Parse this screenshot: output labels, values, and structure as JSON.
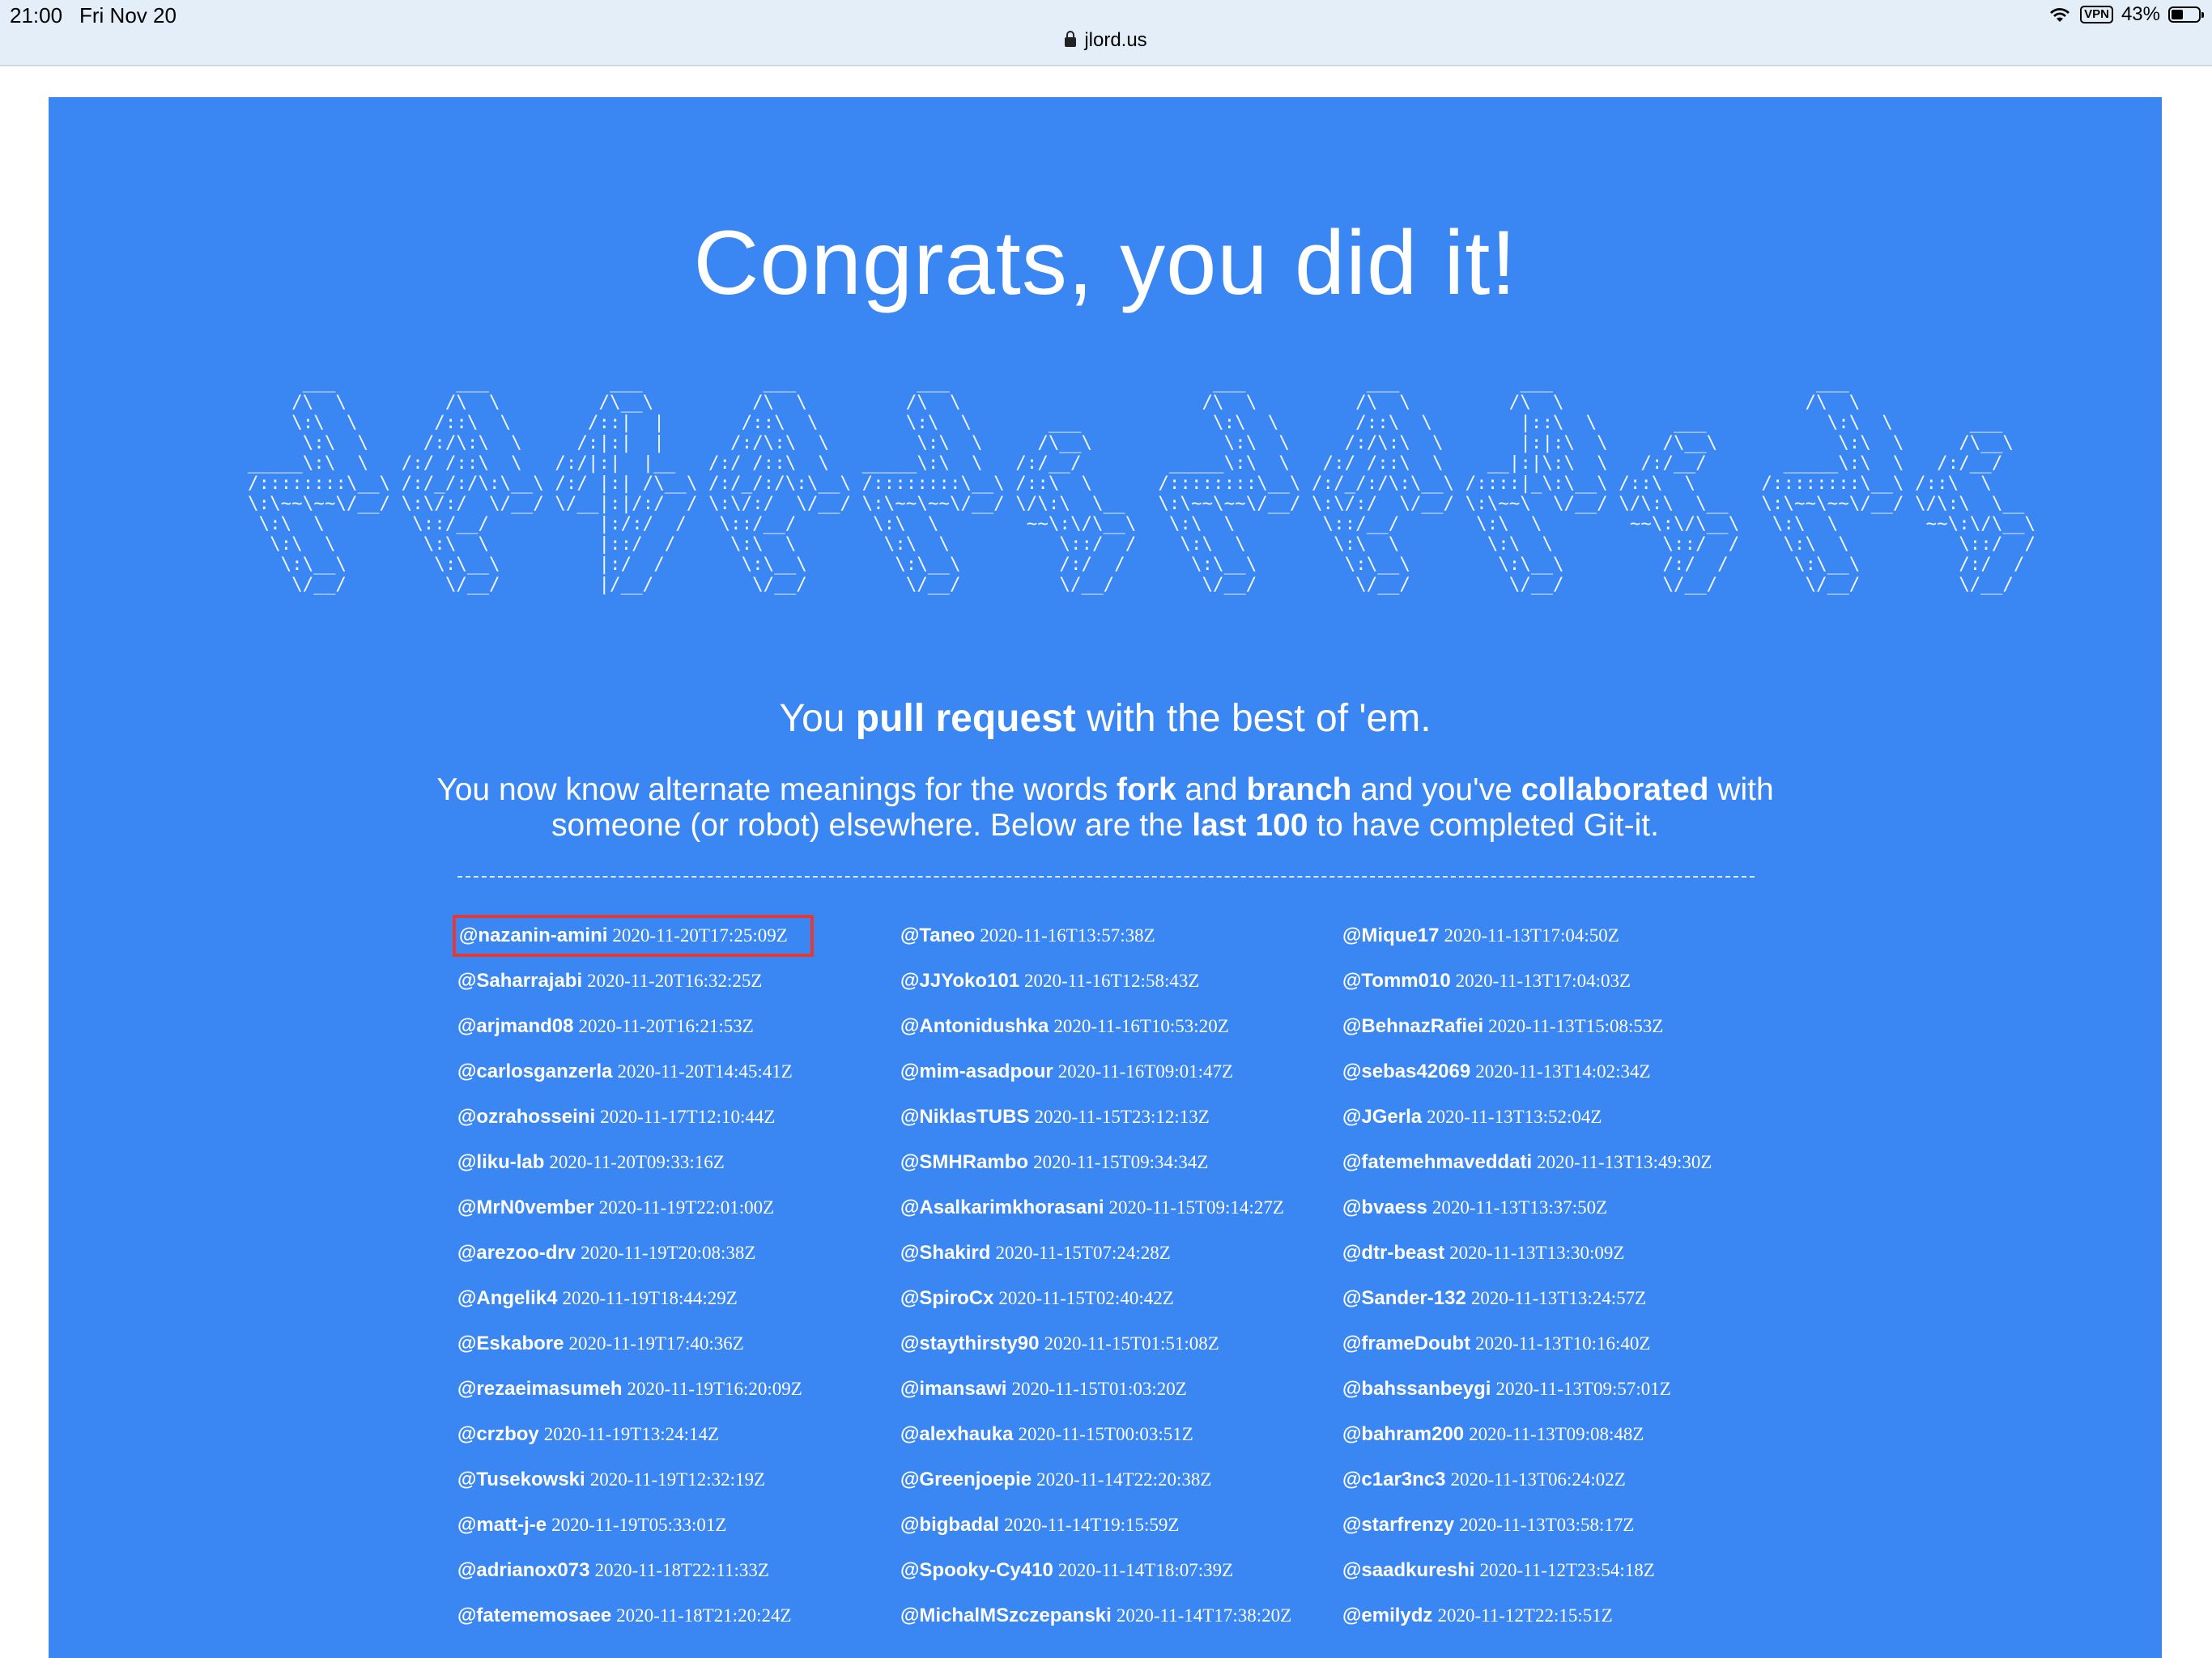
{
  "status_bar": {
    "time": "21:00",
    "date": "Fri Nov 20",
    "url": "jlord.us",
    "vpn": "VPN",
    "battery_percent": "43%",
    "battery_level": 0.43
  },
  "page": {
    "background_color": "#3a86f2",
    "highlight_color": "#e53935",
    "title": "Congrats, you did it!",
    "ascii_art": "     ___           ___           ___           ___           ___                        ___           ___           ___                        ___              \n    /\\  \\         /\\  \\         /\\__\\         /\\  \\         /\\  \\                      /\\  \\         /\\  \\         /\\  \\                      /\\  \\             \n    \\:\\  \\       /::\\  \\       /::|  |       /::\\  \\        \\:\\  \\       ___            \\:\\  \\       /::\\  \\        |::\\  \\       ___           \\:\\  \\       ___   \n     \\:\\  \\     /:/\\:\\  \\     /:|:|  |      /:/\\:\\  \\        \\:\\  \\     /\\__\\            \\:\\  \\     /:/\\:\\  \\       |:|:\\  \\     /\\__\\           \\:\\  \\     /\\__\\  \n_____\\:\\  \\   /:/ /::\\  \\   /:/|:|  |__   /:/ /::\\  \\   _____\\:\\  \\   /:/__/        _____\\:\\  \\   /:/ /::\\  \\    __|:|\\:\\  \\   /:/__/       _____\\:\\  \\   /:/__/  \n/::::::::\\__\\ /:/_/:/\\:\\__\\ /:/ |:| /\\__\\ /:/_/:/\\:\\__\\ /::::::::\\__\\ /::\\  \\      /::::::::\\__\\ /:/_/:/\\:\\__\\ /::::|_\\:\\__\\ /::\\  \\      /::::::::\\__\\ /::\\  \\  \n\\:\\~~\\~~\\/__/ \\:\\/:/  \\/__/ \\/__|:|/:/  / \\:\\/:/  \\/__/ \\:\\~~\\~~\\/__/ \\/\\:\\  \\__   \\:\\~~\\~~\\/__/ \\:\\/:/  \\/__/ \\:\\~~\\  \\/__/ \\/\\:\\  \\__   \\:\\~~\\~~\\/__/ \\/\\:\\  \\__ \n \\:\\  \\        \\::/__/          |:/:/  /   \\::/__/       \\:\\  \\        ~~\\:\\/\\__\\   \\:\\  \\        \\::/__/       \\:\\  \\        ~~\\:\\/\\__\\   \\:\\  \\        ~~\\:\\/\\__\\\n  \\:\\  \\        \\:\\  \\          |::/  /     \\:\\  \\        \\:\\  \\          \\::/  /    \\:\\  \\        \\:\\  \\        \\:\\  \\          \\::/  /    \\:\\  \\          \\::/  /\n   \\:\\__\\        \\:\\__\\         |:/  /       \\:\\__\\        \\:\\__\\         /:/  /      \\:\\__\\        \\:\\__\\        \\:\\__\\         /:/  /      \\:\\__\\         /:/  / \n    \\/__/         \\/__/         |/__/         \\/__/         \\/__/         \\/__/        \\/__/         \\/__/         \\/__/         \\/__/        \\/__/         \\/__/  ",
    "tagline": {
      "pre": "You ",
      "bold": "pull request",
      "post": " with the best of 'em."
    },
    "description": {
      "p1": "You now know alternate meanings for the words ",
      "b1": "fork",
      "p2": " and ",
      "b2": "branch",
      "p3": " and you've ",
      "b3": "collaborated",
      "p4": " with someone (or robot) elsewhere. Below are the ",
      "b4": "last 100",
      "p5": " to have completed Git-it."
    }
  },
  "completions": {
    "col1": [
      {
        "user": "@nazanin-amini",
        "ts": "2020-11-20T17:25:09Z"
      },
      {
        "user": "@Saharrajabi",
        "ts": "2020-11-20T16:32:25Z"
      },
      {
        "user": "@arjmand08",
        "ts": "2020-11-20T16:21:53Z"
      },
      {
        "user": "@carlosganzerla",
        "ts": "2020-11-20T14:45:41Z"
      },
      {
        "user": "@ozrahosseini",
        "ts": "2020-11-17T12:10:44Z"
      },
      {
        "user": "@liku-lab",
        "ts": "2020-11-20T09:33:16Z"
      },
      {
        "user": "@MrN0vember",
        "ts": "2020-11-19T22:01:00Z"
      },
      {
        "user": "@arezoo-drv",
        "ts": "2020-11-19T20:08:38Z"
      },
      {
        "user": "@Angelik4",
        "ts": "2020-11-19T18:44:29Z"
      },
      {
        "user": "@Eskabore",
        "ts": "2020-11-19T17:40:36Z"
      },
      {
        "user": "@rezaeimasumeh",
        "ts": "2020-11-19T16:20:09Z"
      },
      {
        "user": "@crzboy",
        "ts": "2020-11-19T13:24:14Z"
      },
      {
        "user": "@Tusekowski",
        "ts": "2020-11-19T12:32:19Z"
      },
      {
        "user": "@matt-j-e",
        "ts": "2020-11-19T05:33:01Z"
      },
      {
        "user": "@adrianox073",
        "ts": "2020-11-18T22:11:33Z"
      },
      {
        "user": "@fatememosaee",
        "ts": "2020-11-18T21:20:24Z"
      }
    ],
    "col2": [
      {
        "user": "@Taneo",
        "ts": "2020-11-16T13:57:38Z"
      },
      {
        "user": "@JJYoko101",
        "ts": "2020-11-16T12:58:43Z"
      },
      {
        "user": "@Antonidushka",
        "ts": "2020-11-16T10:53:20Z"
      },
      {
        "user": "@mim-asadpour",
        "ts": "2020-11-16T09:01:47Z"
      },
      {
        "user": "@NiklasTUBS",
        "ts": "2020-11-15T23:12:13Z"
      },
      {
        "user": "@SMHRambo",
        "ts": "2020-11-15T09:34:34Z"
      },
      {
        "user": "@Asalkarimkhorasani",
        "ts": "2020-11-15T09:14:27Z"
      },
      {
        "user": "@Shakird",
        "ts": "2020-11-15T07:24:28Z"
      },
      {
        "user": "@SpiroCx",
        "ts": "2020-11-15T02:40:42Z"
      },
      {
        "user": "@staythirsty90",
        "ts": "2020-11-15T01:51:08Z"
      },
      {
        "user": "@imansawi",
        "ts": "2020-11-15T01:03:20Z"
      },
      {
        "user": "@alexhauka",
        "ts": "2020-11-15T00:03:51Z"
      },
      {
        "user": "@Greenjoepie",
        "ts": "2020-11-14T22:20:38Z"
      },
      {
        "user": "@bigbadal",
        "ts": "2020-11-14T19:15:59Z"
      },
      {
        "user": "@Spooky-Cy410",
        "ts": "2020-11-14T18:07:39Z"
      },
      {
        "user": "@MichalMSzczepanski",
        "ts": "2020-11-14T17:38:20Z"
      }
    ],
    "col3": [
      {
        "user": "@Mique17",
        "ts": "2020-11-13T17:04:50Z"
      },
      {
        "user": "@Tomm010",
        "ts": "2020-11-13T17:04:03Z"
      },
      {
        "user": "@BehnazRafiei",
        "ts": "2020-11-13T15:08:53Z"
      },
      {
        "user": "@sebas42069",
        "ts": "2020-11-13T14:02:34Z"
      },
      {
        "user": "@JGerla",
        "ts": "2020-11-13T13:52:04Z"
      },
      {
        "user": "@fatemehmaveddati",
        "ts": "2020-11-13T13:49:30Z"
      },
      {
        "user": "@bvaess",
        "ts": "2020-11-13T13:37:50Z"
      },
      {
        "user": "@dtr-beast",
        "ts": "2020-11-13T13:30:09Z"
      },
      {
        "user": "@Sander-132",
        "ts": "2020-11-13T13:24:57Z"
      },
      {
        "user": "@frameDoubt",
        "ts": "2020-11-13T10:16:40Z"
      },
      {
        "user": "@bahssanbeygi",
        "ts": "2020-11-13T09:57:01Z"
      },
      {
        "user": "@bahram200",
        "ts": "2020-11-13T09:08:48Z"
      },
      {
        "user": "@c1ar3nc3",
        "ts": "2020-11-13T06:24:02Z"
      },
      {
        "user": "@starfrenzy",
        "ts": "2020-11-13T03:58:17Z"
      },
      {
        "user": "@saadkureshi",
        "ts": "2020-11-12T23:54:18Z"
      },
      {
        "user": "@emilydz",
        "ts": "2020-11-12T22:15:51Z"
      }
    ]
  }
}
